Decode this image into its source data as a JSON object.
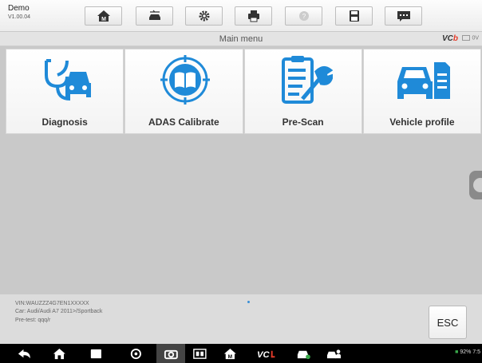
{
  "app": {
    "name": "Demo",
    "version": "V1.00.04"
  },
  "toolbar": {
    "buttons": [
      {
        "name": "home-button",
        "icon": "home-icon"
      },
      {
        "name": "vehicle-swap-button",
        "icon": "vehicle-swap-icon"
      },
      {
        "name": "settings-button",
        "icon": "gear-icon"
      },
      {
        "name": "print-button",
        "icon": "printer-icon"
      },
      {
        "name": "help-button",
        "icon": "help-icon"
      },
      {
        "name": "save-button",
        "icon": "save-icon"
      },
      {
        "name": "message-button",
        "icon": "chat-icon"
      }
    ]
  },
  "header": {
    "title": "Main menu",
    "vci_prefix": "VC",
    "vci_suffix": "b",
    "voltage": "0V"
  },
  "tiles": [
    {
      "label": "Diagnosis",
      "icon": "stethoscope-car-icon"
    },
    {
      "label": "ADAS Calibrate",
      "icon": "book-target-icon"
    },
    {
      "label": "Pre-Scan",
      "icon": "clipboard-wrench-icon"
    },
    {
      "label": "Vehicle profile",
      "icon": "car-document-icon"
    }
  ],
  "info": {
    "vin": "VIN:WAUZZZ4G7EN1XXXXX",
    "car": "Car: Audi/Audi A7 2011>/Sportback",
    "pretest": "Pre-test: qqq/r"
  },
  "esc_label": "ESC",
  "statusbar": {
    "text": "92%  7:5"
  },
  "colors": {
    "icon_blue": "#1f8ad8",
    "nav_bg": "#000000"
  }
}
